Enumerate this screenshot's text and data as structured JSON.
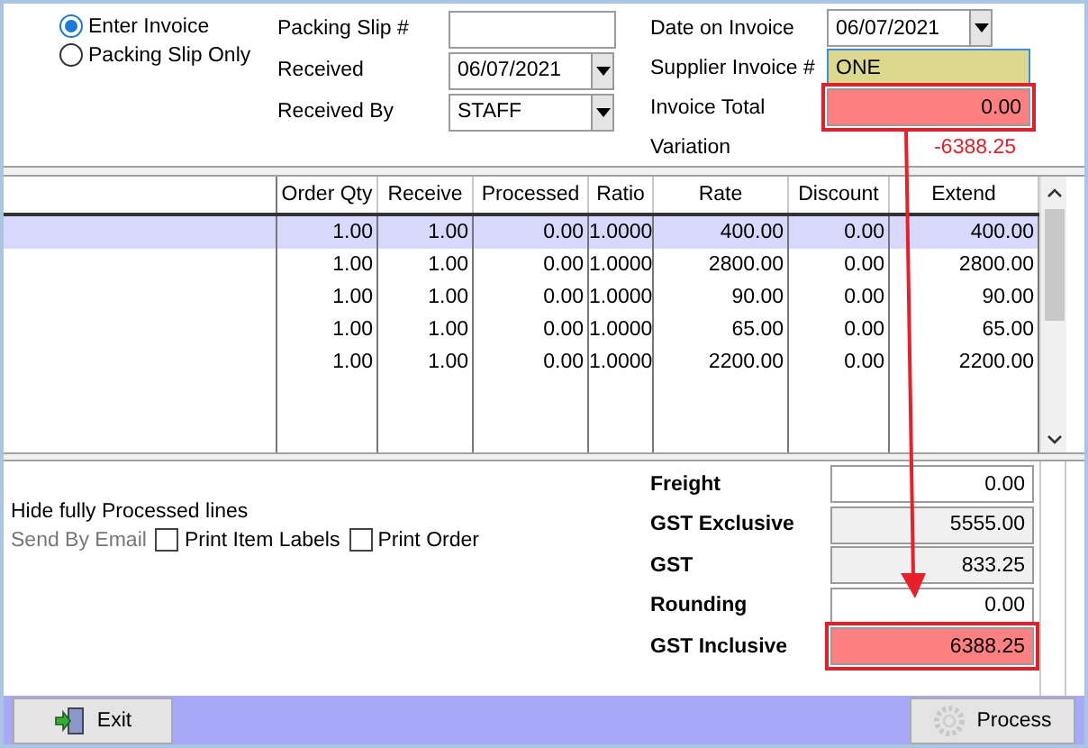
{
  "invoice_mode": [
    {
      "label": "Enter Invoice",
      "selected": true
    },
    {
      "label": "Packing Slip Only",
      "selected": false
    }
  ],
  "receipt": {
    "packing_slip": {
      "label": "Packing Slip #"
    },
    "received": {
      "label": "Received",
      "value": "06/07/2021"
    },
    "received_by": {
      "label": "Received By",
      "value": "STAFF"
    }
  },
  "invoice": {
    "date": {
      "label": "Date on Invoice",
      "value": "06/07/2021"
    },
    "supplier_invoice": {
      "label": "Supplier Invoice #",
      "value": "ONE",
      "focused": true
    },
    "total": {
      "label": "Invoice Total",
      "value": "0.00",
      "flagged": true
    },
    "variation": {
      "label": "Variation",
      "value": "-6388.25"
    }
  },
  "table": {
    "columns": [
      "Order Qty",
      "Receive",
      "Processed",
      "Ratio",
      "Rate",
      "Discount",
      "Extend"
    ],
    "rows": [
      {
        "cells": [
          "1.00",
          "1.00",
          "0.00",
          "1.0000",
          "400.00",
          "0.00",
          "400.00"
        ],
        "selected": true
      },
      {
        "cells": [
          "1.00",
          "1.00",
          "0.00",
          "1.0000",
          "2800.00",
          "0.00",
          "2800.00"
        ],
        "selected": false
      },
      {
        "cells": [
          "1.00",
          "1.00",
          "0.00",
          "1.0000",
          "90.00",
          "0.00",
          "90.00"
        ],
        "selected": false
      },
      {
        "cells": [
          "1.00",
          "1.00",
          "0.00",
          "1.0000",
          "65.00",
          "0.00",
          "65.00"
        ],
        "selected": false
      },
      {
        "cells": [
          "1.00",
          "1.00",
          "0.00",
          "1.0000",
          "2200.00",
          "0.00",
          "2200.00"
        ],
        "selected": false
      }
    ]
  },
  "options": {
    "hide_processed": "Hide fully Processed lines",
    "send_by_email": {
      "label": "Send By Email",
      "disabled": true
    },
    "checkboxes": [
      {
        "label": "Print Item Labels",
        "checked": false
      },
      {
        "label": "Print Order",
        "checked": false
      }
    ]
  },
  "totals": [
    {
      "label": "Freight",
      "value": "0.00",
      "readonly": false,
      "flagged": false
    },
    {
      "label": "GST Exclusive",
      "value": "5555.00",
      "readonly": true,
      "flagged": false
    },
    {
      "label": "GST",
      "value": "833.25",
      "readonly": true,
      "flagged": false
    },
    {
      "label": "Rounding",
      "value": "0.00",
      "readonly": false,
      "flagged": false
    },
    {
      "label": "GST Inclusive",
      "value": "6388.25",
      "readonly": true,
      "flagged": true
    }
  ],
  "annotations": [
    {
      "kind": "arrow"
    }
  ],
  "buttons": {
    "exit": "Exit",
    "process": "Process"
  }
}
